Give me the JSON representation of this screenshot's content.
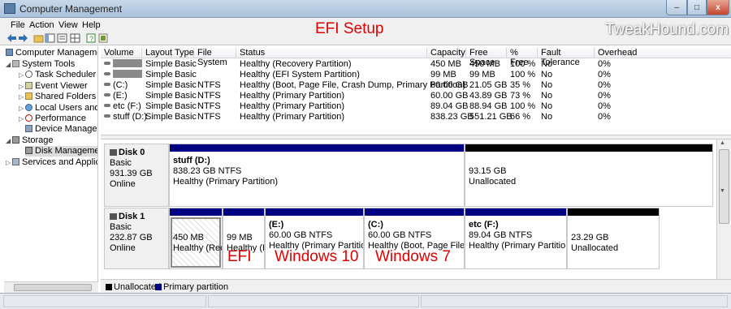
{
  "window": {
    "title": "Computer Management",
    "min": "–",
    "max": "□",
    "close": "x"
  },
  "menu": [
    "File",
    "Action",
    "View",
    "Help"
  ],
  "overlay": {
    "title": "EFI Setup",
    "watermark": "TweakHound.com"
  },
  "tree": [
    {
      "label": "Computer Management",
      "icon": "computer-icon"
    },
    {
      "label": "System Tools",
      "icon": "tools-icon"
    },
    {
      "label": "Task Scheduler",
      "icon": "clock-icon"
    },
    {
      "label": "Event Viewer",
      "icon": "event-viewer-icon"
    },
    {
      "label": "Shared Folders",
      "icon": "folder-icon"
    },
    {
      "label": "Local Users and Groups",
      "icon": "users-icon"
    },
    {
      "label": "Performance",
      "icon": "performance-icon"
    },
    {
      "label": "Device Manager",
      "icon": "device-manager-icon"
    },
    {
      "label": "Storage",
      "icon": "storage-icon"
    },
    {
      "label": "Disk Management",
      "icon": "disk-management-icon"
    },
    {
      "label": "Services and Applications",
      "icon": "services-icon"
    }
  ],
  "volume_table": {
    "headers": [
      "Volume",
      "Layout",
      "Type",
      "File System",
      "Status",
      "Capacity",
      "Free Space",
      "% Free",
      "Fault Tolerance",
      "Overhead"
    ],
    "rows": [
      [
        "",
        "Simple",
        "Basic",
        "",
        "Healthy (Recovery Partition)",
        "450 MB",
        "450 MB",
        "100 %",
        "No",
        "0%"
      ],
      [
        "",
        "Simple",
        "Basic",
        "",
        "Healthy (EFI System Partition)",
        "99 MB",
        "99 MB",
        "100 %",
        "No",
        "0%"
      ],
      [
        "(C:)",
        "Simple",
        "Basic",
        "NTFS",
        "Healthy (Boot, Page File, Crash Dump, Primary Partition)",
        "60.00 GB",
        "21.05 GB",
        "35 %",
        "No",
        "0%"
      ],
      [
        "(E:)",
        "Simple",
        "Basic",
        "NTFS",
        "Healthy (Primary Partition)",
        "60.00 GB",
        "43.89 GB",
        "73 %",
        "No",
        "0%"
      ],
      [
        "etc (F:)",
        "Simple",
        "Basic",
        "NTFS",
        "Healthy (Primary Partition)",
        "89.04 GB",
        "88.94 GB",
        "100 %",
        "No",
        "0%"
      ],
      [
        "stuff (D:)",
        "Simple",
        "Basic",
        "NTFS",
        "Healthy (Primary Partition)",
        "838.23 GB",
        "551.21 GB",
        "66 %",
        "No",
        "0%"
      ]
    ]
  },
  "disks": [
    {
      "name": "Disk 0",
      "type": "Basic",
      "size": "931.39 GB",
      "status": "Online",
      "partitions": [
        {
          "name": "stuff  (D:)",
          "size": "838.23 GB NTFS",
          "status": "Healthy (Primary Partition)",
          "kind": "primary"
        },
        {
          "name": "",
          "size": "93.15 GB",
          "status": "Unallocated",
          "kind": "unallocated"
        }
      ]
    },
    {
      "name": "Disk 1",
      "type": "Basic",
      "size": "232.87 GB",
      "status": "Online",
      "partitions": [
        {
          "name": "",
          "size": "450 MB",
          "status": "Healthy (Reco",
          "kind": "primary"
        },
        {
          "name": "",
          "size": "99 MB",
          "status": "Healthy (E",
          "kind": "primary"
        },
        {
          "name": "(E:)",
          "size": "60.00 GB NTFS",
          "status": "Healthy (Primary Partition)",
          "kind": "primary"
        },
        {
          "name": "(C:)",
          "size": "60.00 GB NTFS",
          "status": "Healthy (Boot, Page File, Cra",
          "kind": "primary"
        },
        {
          "name": "etc  (F:)",
          "size": "89.04 GB NTFS",
          "status": "Healthy (Primary Partition)",
          "kind": "primary"
        },
        {
          "name": "",
          "size": "23.29 GB",
          "status": "Unallocated",
          "kind": "unallocated"
        }
      ]
    }
  ],
  "annotations": {
    "efi": "EFI",
    "win10": "Windows 10",
    "win7": "Windows 7"
  },
  "legend": {
    "unallocated": "Unallocated",
    "primary": "Primary partition"
  },
  "colors": {
    "primary": "#000080",
    "unallocated": "#000000",
    "overlay_red": "#e00000"
  }
}
